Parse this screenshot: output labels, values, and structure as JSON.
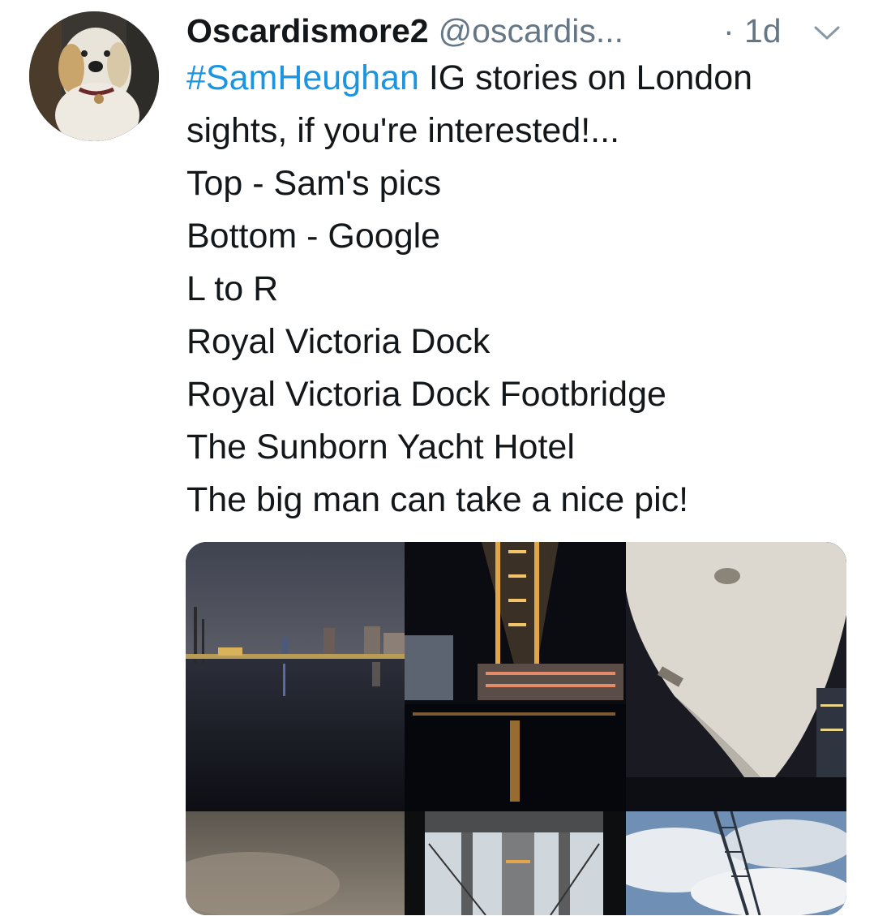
{
  "tweet": {
    "display_name": "Oscardismore2",
    "handle": "@oscardis...",
    "separator": "·",
    "time": "1d",
    "hashtag": "#SamHeughan",
    "lines": [
      " IG stories on London",
      "sights, if you're interested!...",
      "Top - Sam's pics",
      "Bottom - Google",
      "L to R",
      "Royal Victoria Dock",
      "Royal Victoria Dock Footbridge",
      "The Sunborn Yacht Hotel",
      "The big man can take a nice pic!"
    ]
  },
  "icons": {
    "avatar": "dog-avatar",
    "menu": "chevron-down-icon"
  },
  "colors": {
    "hashtag": "#1b95e0",
    "secondary_text": "#657786",
    "primary_text": "#14171a"
  }
}
